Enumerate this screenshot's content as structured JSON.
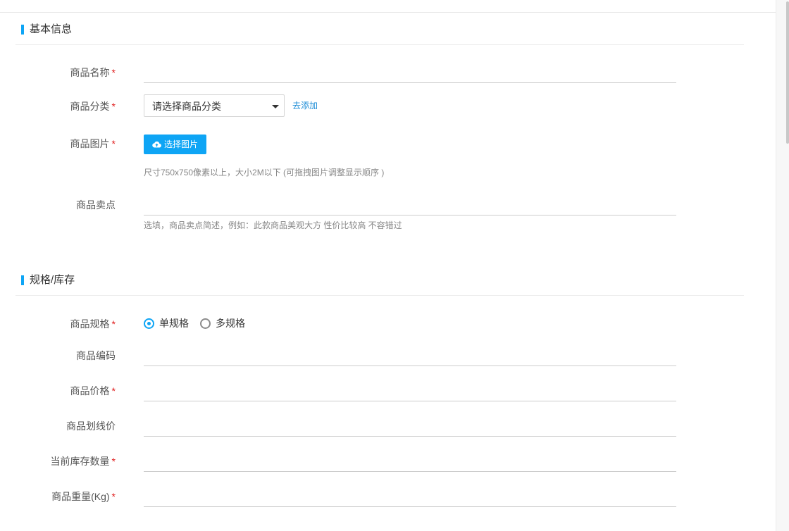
{
  "sections": {
    "basic": {
      "title": "基本信息"
    },
    "spec": {
      "title": "规格/库存"
    }
  },
  "form": {
    "name": {
      "label": "商品名称",
      "required": "*",
      "value": ""
    },
    "category": {
      "label": "商品分类",
      "required": "*",
      "selected": "请选择商品分类",
      "add_link": "去添加"
    },
    "image": {
      "label": "商品图片",
      "required": "*",
      "button": "选择图片",
      "hint": "尺寸750x750像素以上，大小2M以下 (可拖拽图片调整显示顺序 )"
    },
    "selling_point": {
      "label": "商品卖点",
      "value": "",
      "hint": "选填，商品卖点简述，例如：此款商品美观大方 性价比较高 不容错过"
    },
    "spec_type": {
      "label": "商品规格",
      "required": "*",
      "options": [
        "单规格",
        "多规格"
      ],
      "selected": "单规格"
    },
    "code": {
      "label": "商品编码",
      "value": ""
    },
    "price": {
      "label": "商品价格",
      "required": "*",
      "value": ""
    },
    "line_price": {
      "label": "商品划线价",
      "value": ""
    },
    "stock": {
      "label": "当前库存数量",
      "required": "*",
      "value": ""
    },
    "weight": {
      "label": "商品重量(Kg)",
      "required": "*",
      "value": ""
    }
  },
  "icons": {
    "upload": "cloud-upload-icon",
    "caret": "caret-down-icon"
  },
  "colors": {
    "accent": "#0ea5f5",
    "required": "#e02020",
    "link": "#1a8bd6"
  }
}
